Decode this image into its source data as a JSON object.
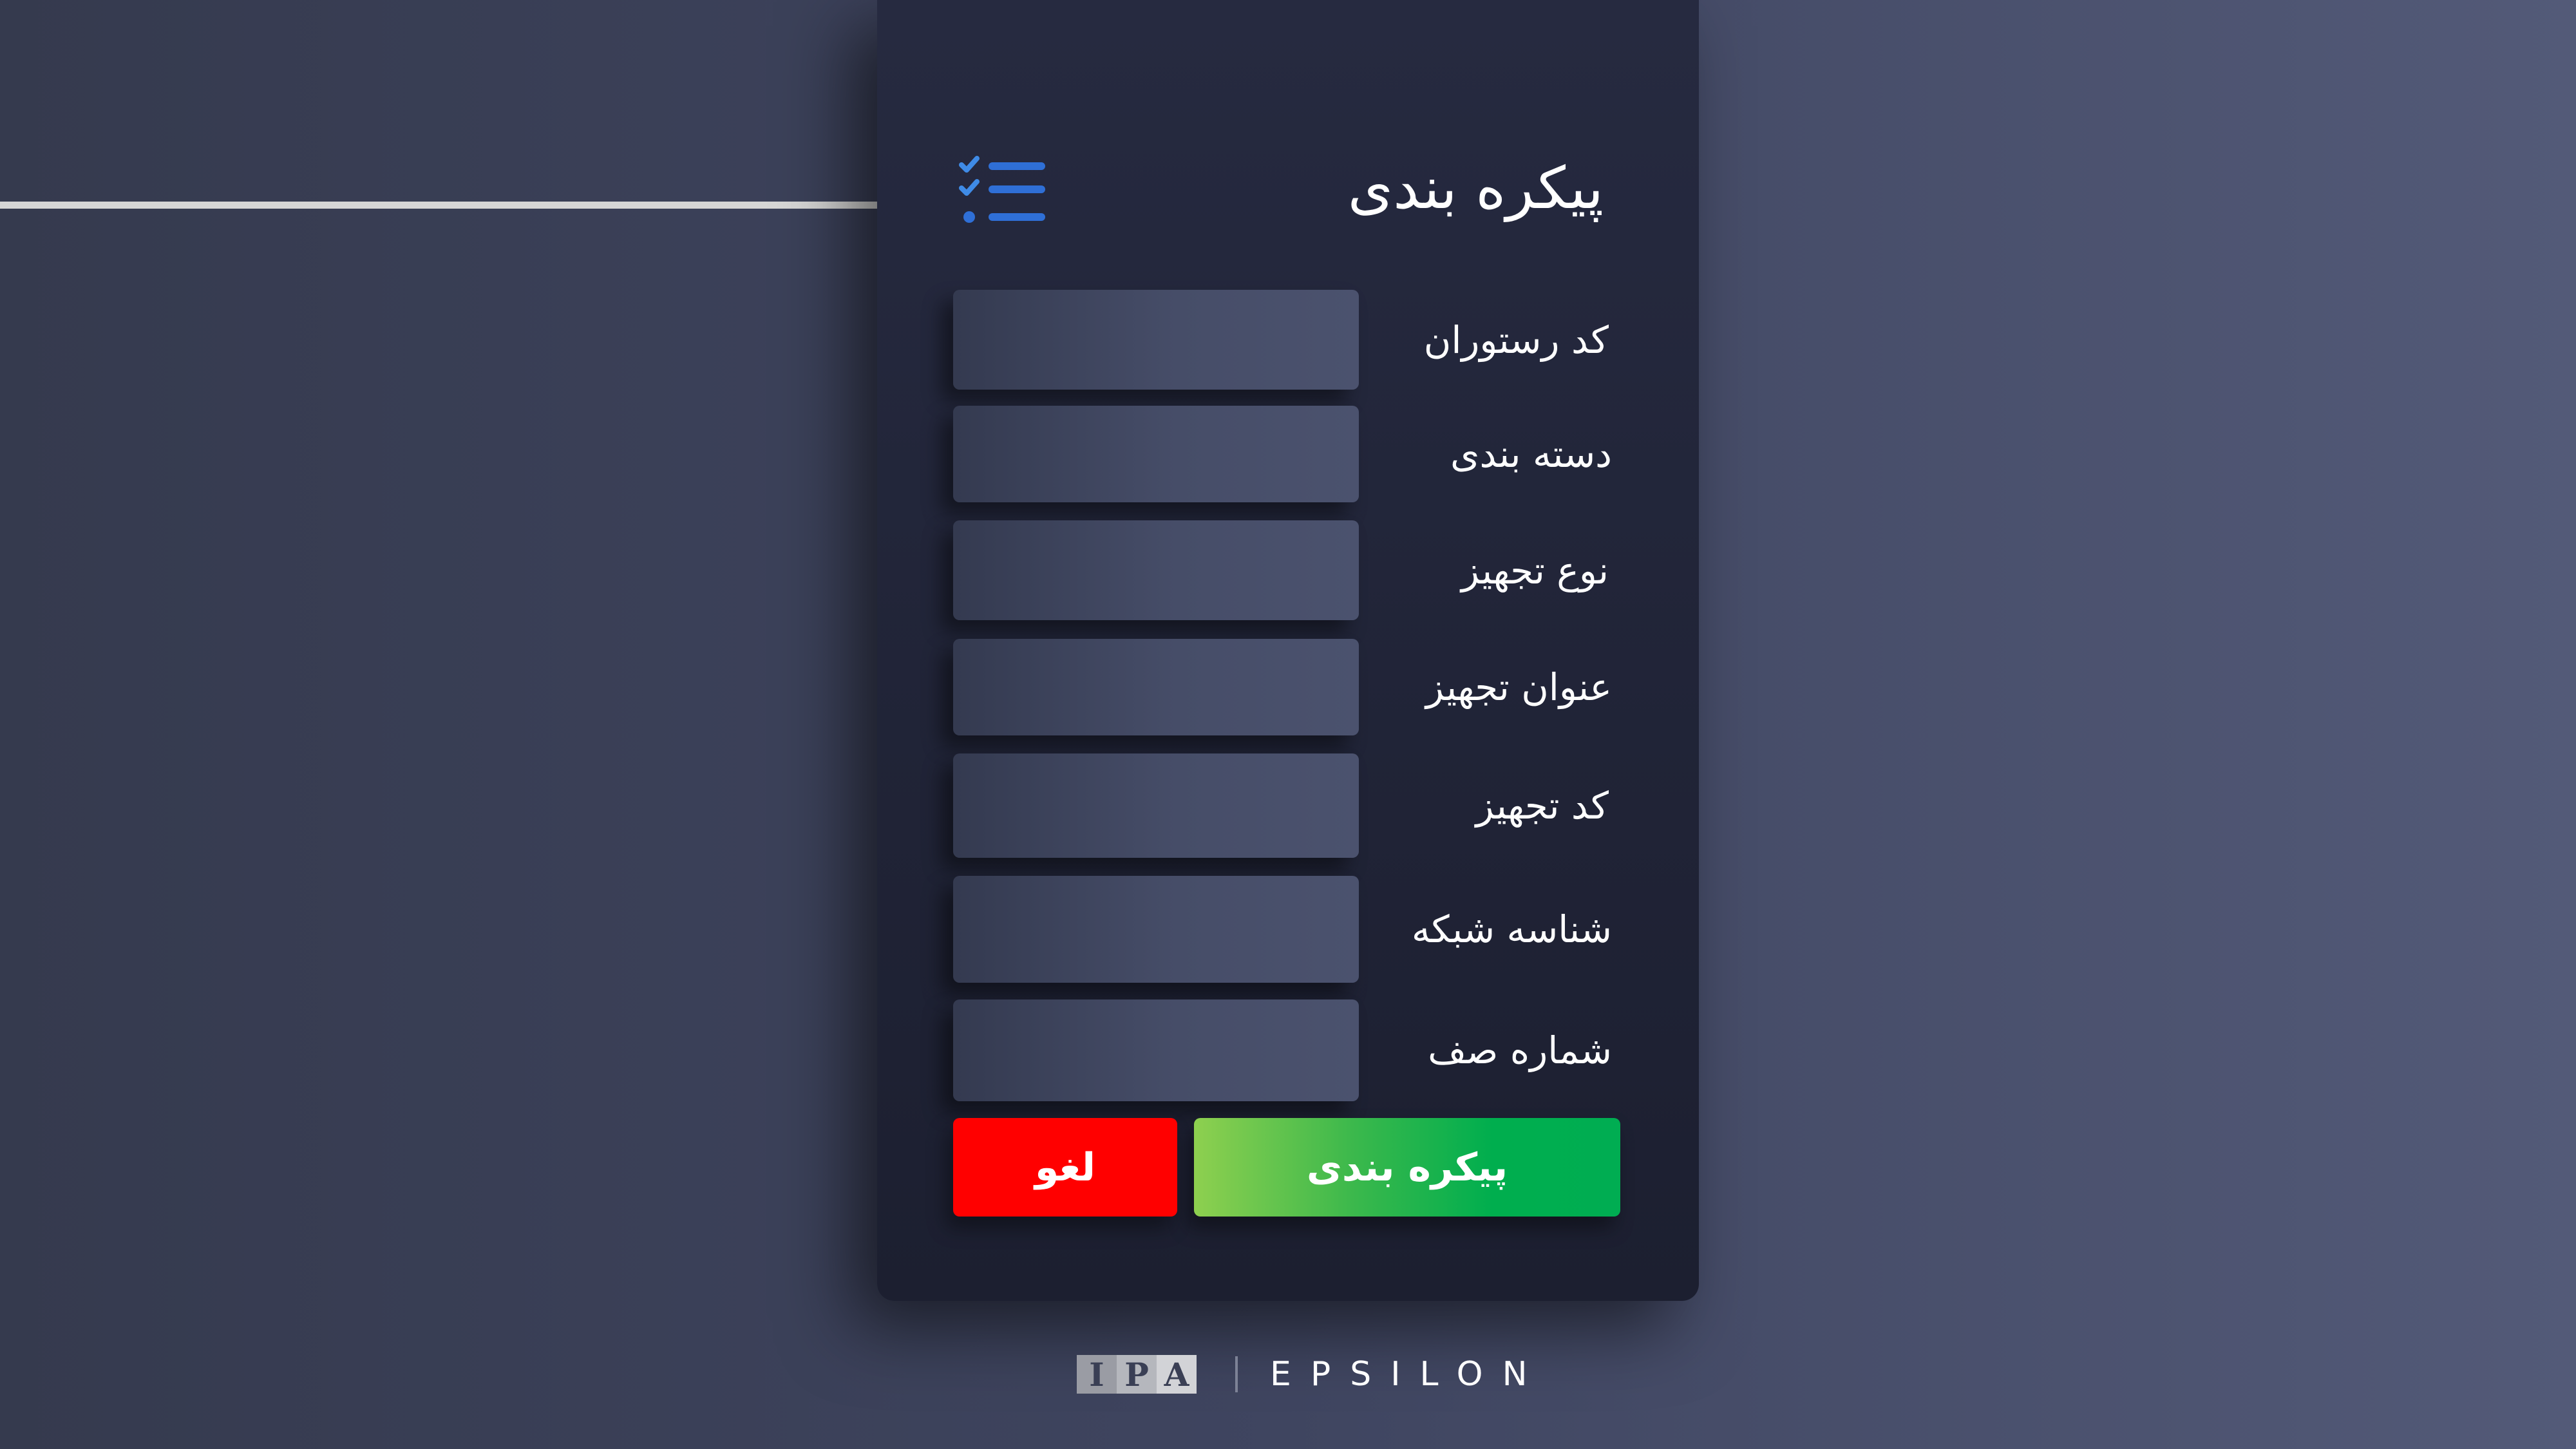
{
  "form": {
    "title": "پیکره بندی",
    "fields": [
      {
        "label": "کد رستوران",
        "value": ""
      },
      {
        "label": "دسته بندی",
        "value": ""
      },
      {
        "label": "نوع تجهیز",
        "value": ""
      },
      {
        "label": "عنوان تجهیز",
        "value": ""
      },
      {
        "label": "کد تجهیز",
        "value": ""
      },
      {
        "label": "شناسه شبکه",
        "value": ""
      },
      {
        "label": "شماره صف",
        "value": ""
      }
    ],
    "submit_label": "پیکره بندی",
    "cancel_label": "لغو"
  },
  "footer": {
    "logo_letters": [
      "I",
      "P",
      "A"
    ],
    "brand": "EPSILON"
  },
  "icons": {
    "header_icon": "checklist-icon"
  },
  "colors": {
    "submit": "#00ae4e",
    "cancel": "#ff0000",
    "icon_accent": "#2f6fd6"
  }
}
